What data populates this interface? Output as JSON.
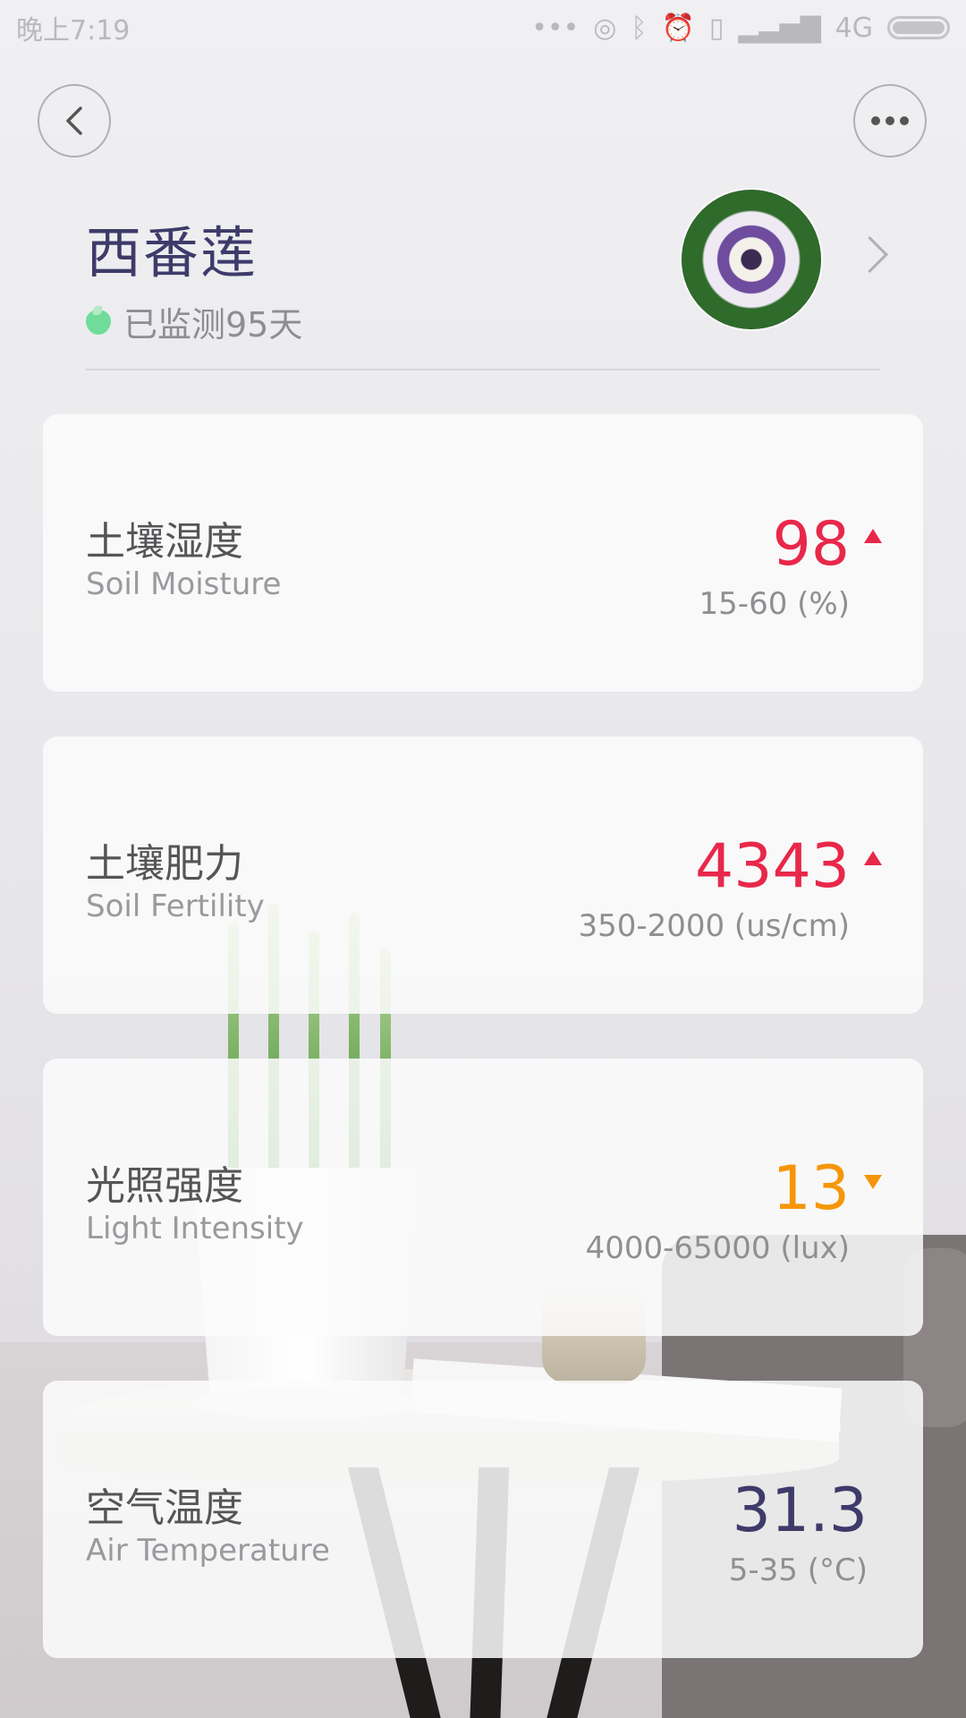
{
  "status_bar": {
    "time": "晚上7:19",
    "network": "4G",
    "icons": [
      "dots-icon",
      "hotspot-icon",
      "bluetooth-icon",
      "alarm-icon",
      "vibrate-icon",
      "signal-icon",
      "battery-icon"
    ]
  },
  "header": {
    "plant_name": "西番莲",
    "monitor_text": "已监测95天"
  },
  "colors": {
    "high": "#e8284a",
    "low": "#f5960a",
    "normal": "#3e3b6a"
  },
  "cards": [
    {
      "name_cn": "土壤湿度",
      "name_en": "Soil Moisture",
      "value": "98",
      "range": "15-60 (%)",
      "status": "high"
    },
    {
      "name_cn": "土壤肥力",
      "name_en": "Soil Fertility",
      "value": "4343",
      "range": "350-2000 (us/cm)",
      "status": "high"
    },
    {
      "name_cn": "光照强度",
      "name_en": "Light Intensity",
      "value": "13",
      "range": "4000-65000 (lux)",
      "status": "low"
    },
    {
      "name_cn": "空气温度",
      "name_en": "Air Temperature",
      "value": "31.3",
      "range": "5-35 (°C)",
      "status": "normal"
    }
  ]
}
